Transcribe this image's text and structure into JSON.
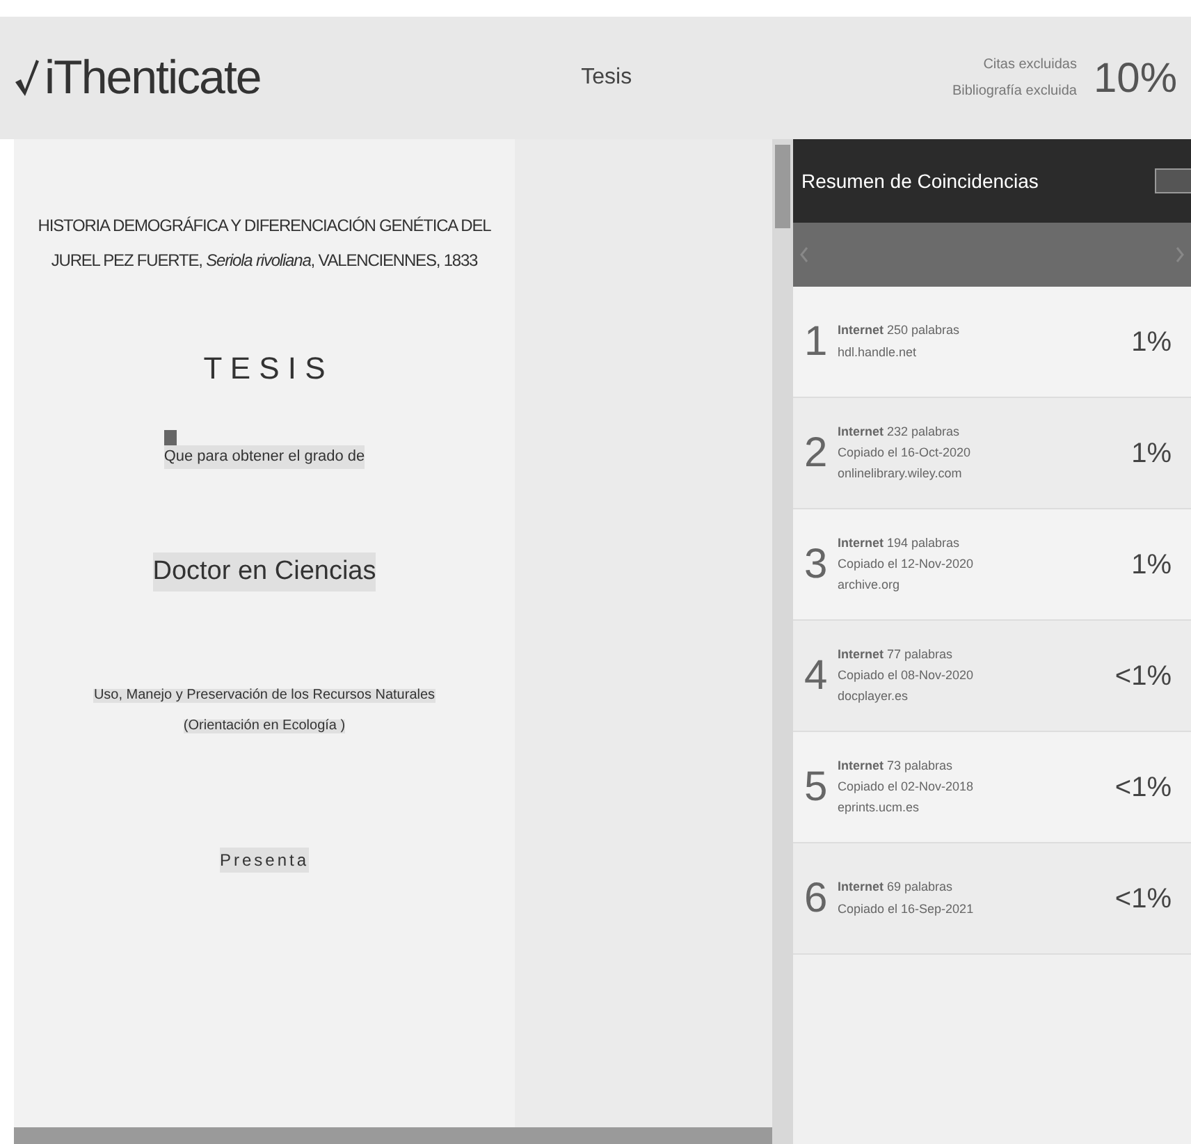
{
  "header": {
    "logo": "iThenticate",
    "document_title": "Tesis",
    "filters": [
      "Citas excluidas",
      "Bibliografía excluida"
    ],
    "similarity": "10%"
  },
  "document": {
    "paragraphs": [
      {
        "kind": "title",
        "text": "HISTORIA DEMOGRÁFICA Y DIFERENCIACIÓN GENÉTICA DEL JUREL PEZ FUERTE, *Seriola rivoliana*, VALENCIENNES, 1833",
        "highlighted": false
      },
      {
        "kind": "heading",
        "text": "T E S I S",
        "highlighted": false
      },
      {
        "kind": "marked",
        "text": "Que para obtener el grado de",
        "highlighted": true
      },
      {
        "kind": "degree",
        "text": "Doctor en Ciencias",
        "highlighted": true
      },
      {
        "kind": "body",
        "text": "Uso, Manejo y Preservación de los Recursos Naturales",
        "highlighted": true
      },
      {
        "kind": "body",
        "text": "(Orientación en Ecología )",
        "highlighted": true
      },
      {
        "kind": "small",
        "text": "Presenta",
        "highlighted": true
      }
    ]
  },
  "panel": {
    "title": "Resumen de Coincidencias",
    "matches": [
      {
        "number": "1",
        "source": "**Internet** 250 palabras",
        "lines": [
          "hdl.handle.net"
        ],
        "percent": "1%"
      },
      {
        "number": "2",
        "source": "**Internet** 232 palabras",
        "lines": [
          "Copiado el 16-Oct-2020",
          "onlinelibrary.wiley.com"
        ],
        "percent": "1%"
      },
      {
        "number": "3",
        "source": "**Internet** 194 palabras",
        "lines": [
          "Copiado el 12-Nov-2020",
          "archive.org"
        ],
        "percent": "1%"
      },
      {
        "number": "4",
        "source": "**Internet** 77 palabras",
        "lines": [
          "Copiado el 08-Nov-2020",
          "docplayer.es"
        ],
        "percent": "<1%"
      },
      {
        "number": "5",
        "source": "**Internet** 73 palabras",
        "lines": [
          "Copiado el 02-Nov-2018",
          "eprints.ucm.es"
        ],
        "percent": "<1%"
      },
      {
        "number": "6",
        "source": "**Internet** 69 palabras",
        "lines": [
          "Copiado el 16-Sep-2021"
        ],
        "percent": "<1%"
      }
    ]
  }
}
